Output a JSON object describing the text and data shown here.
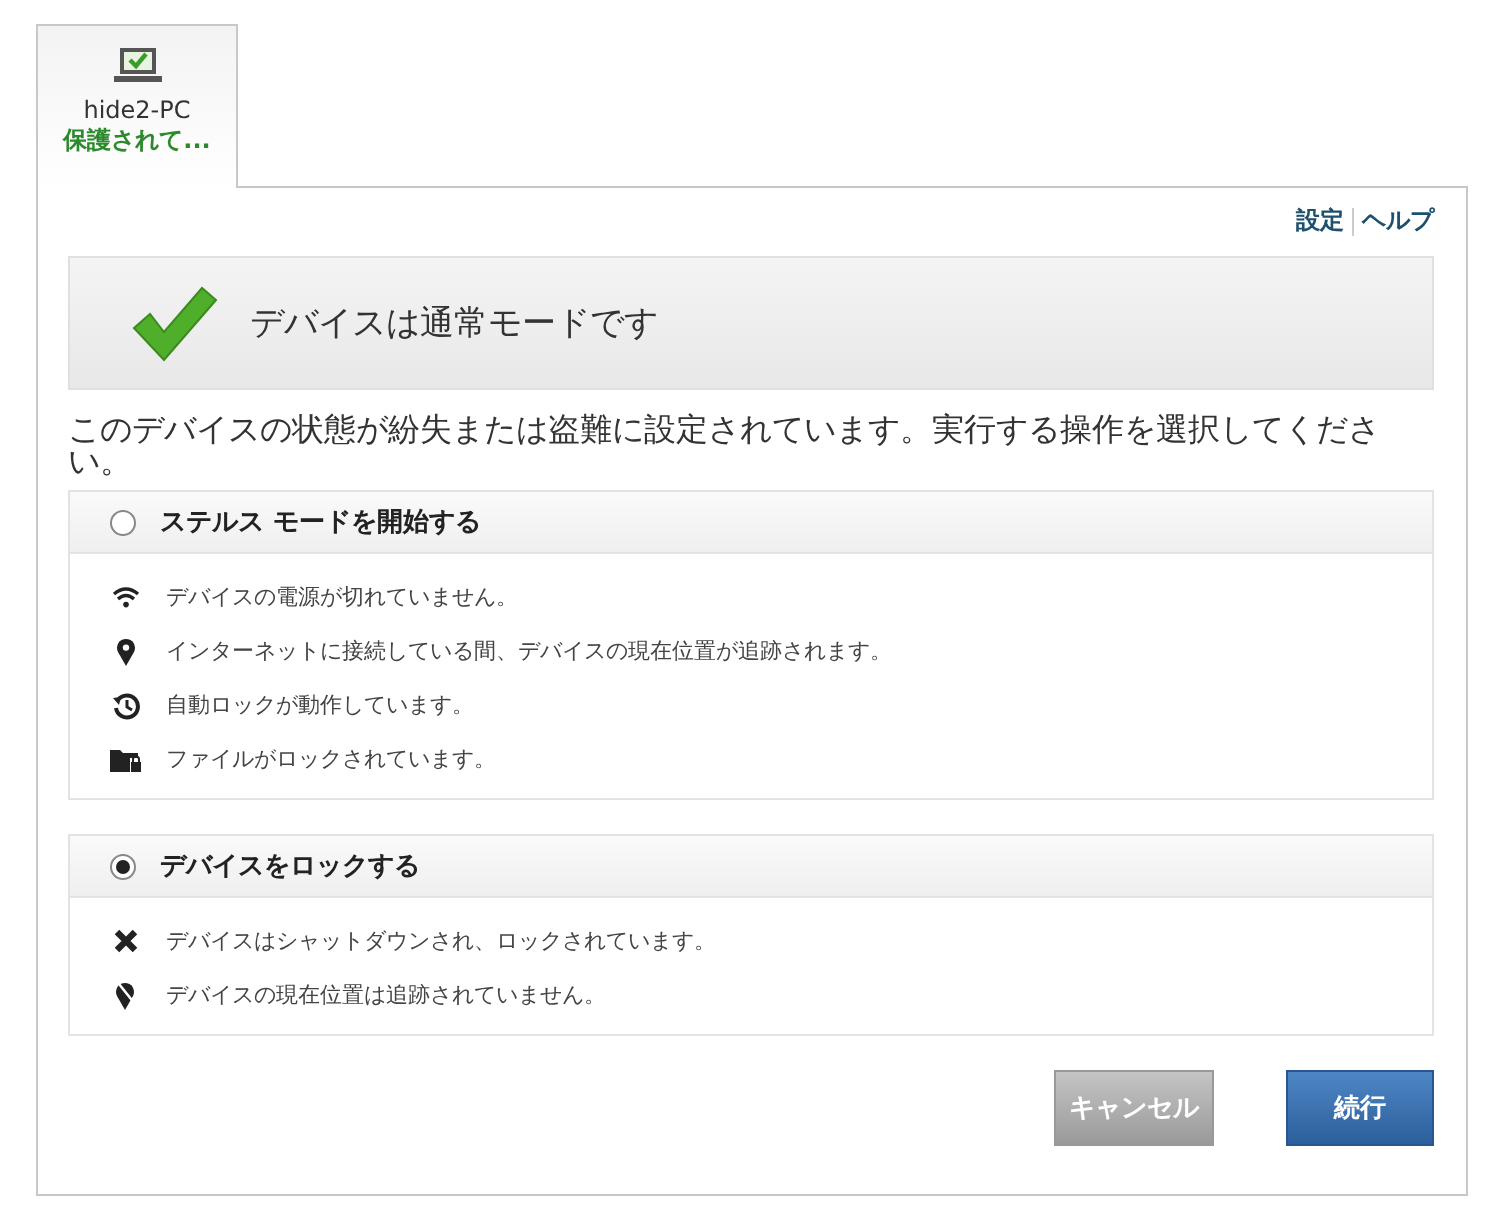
{
  "device_tab": {
    "name": "hide2-PC",
    "status": "保護されて..."
  },
  "links": [
    "設定",
    "ヘルプ"
  ],
  "banner": {
    "title": "デバイスは通常モードです"
  },
  "description": "このデバイスの状態が紛失または盗難に設定されています。実行する操作を選択してください。",
  "options": [
    {
      "label": "ステルス モードを開始する",
      "selected": false,
      "items": [
        {
          "kind": "wifi",
          "text": "デバイスの電源が切れていません。"
        },
        {
          "kind": "pin",
          "text": "インターネットに接続している間、デバイスの現在位置が追跡されます。"
        },
        {
          "kind": "clock",
          "text": "自動ロックが動作しています。"
        },
        {
          "kind": "folder",
          "text": "ファイルがロックされています。"
        }
      ]
    },
    {
      "label": "デバイスをロックする",
      "selected": true,
      "items": [
        {
          "kind": "cross",
          "text": "デバイスはシャットダウンされ、ロックされています。"
        },
        {
          "kind": "pin-off",
          "text": "デバイスの現在位置は追跡されていません。"
        }
      ]
    }
  ],
  "buttons": {
    "cancel": "キャンセル",
    "continue": "続行"
  }
}
